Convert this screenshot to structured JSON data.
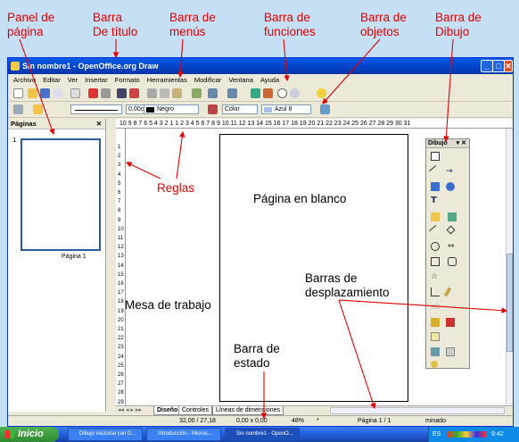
{
  "annotations": {
    "panel_pagina": "Panel de\npágina",
    "barra_titulo": "Barra\nDe título",
    "barra_menus": "Barra de\nmenús",
    "barra_funciones": "Barra de\nfunciones",
    "barra_objetos": "Barra de\nobjetos",
    "barra_dibujo": "Barra de\nDibujo",
    "reglas": "Reglas",
    "pagina_blanco": "Página en blanco",
    "mesa_trabajo": "Mesa de trabajo",
    "barras_desplazamiento": "Barras de\ndesplazamiento",
    "barra_estado": "Barra de\nestado"
  },
  "window": {
    "title": "Sin nombre1 - OpenOffice.org Draw",
    "minimize": "_",
    "maximize": "□",
    "close": "✕"
  },
  "menu": [
    "Archivo",
    "Editar",
    "Ver",
    "Insertar",
    "Formato",
    "Herramientas",
    "Modificar",
    "Ventana",
    "Ayuda"
  ],
  "objects_bar": {
    "line_width": "0,00cm",
    "line_color": "Negro",
    "fill_type": "Color",
    "fill_color": "Azul 8"
  },
  "pages_panel": {
    "title": "Páginas",
    "close": "✕",
    "thumb_number": "1",
    "thumb_label": "Página 1"
  },
  "ruler_h": "10 9 8 7 6 5 4 3 2 1   1 2 3 4 5 6 7 8 9 10 11 12 13 14 15 16 17 18 19 20 21 22 23 24 25 26 27 28 29 30 31",
  "ruler_v": [
    "1",
    "2",
    "3",
    "4",
    "5",
    "6",
    "7",
    "8",
    "9",
    "10",
    "11",
    "12",
    "13",
    "14",
    "15",
    "16",
    "17",
    "18",
    "19",
    "20",
    "21",
    "22",
    "23",
    "24",
    "25",
    "26",
    "27",
    "28",
    "29"
  ],
  "tabs": [
    "Diseño",
    "Controles",
    "Líneas de dimensiones"
  ],
  "status": {
    "position": "32,00 / 27,18",
    "size": "0,00 x 0,00",
    "zoom": "48%",
    "modified": "*",
    "page": "Página 1 / 1",
    "style": "minado"
  },
  "drawing_bar": {
    "title": "Dibujo"
  },
  "taskbar": {
    "start": "Inicio",
    "tasks": [
      "Dibujo vectorial con D...",
      "Introducción - Micros...",
      "Sin nombre1 - OpenO..."
    ],
    "lang": "ES",
    "clock": "9:42"
  },
  "colors": {
    "annotation": "#e30000",
    "title_bar": "#0a5ce8",
    "background": "#c5dff5"
  }
}
